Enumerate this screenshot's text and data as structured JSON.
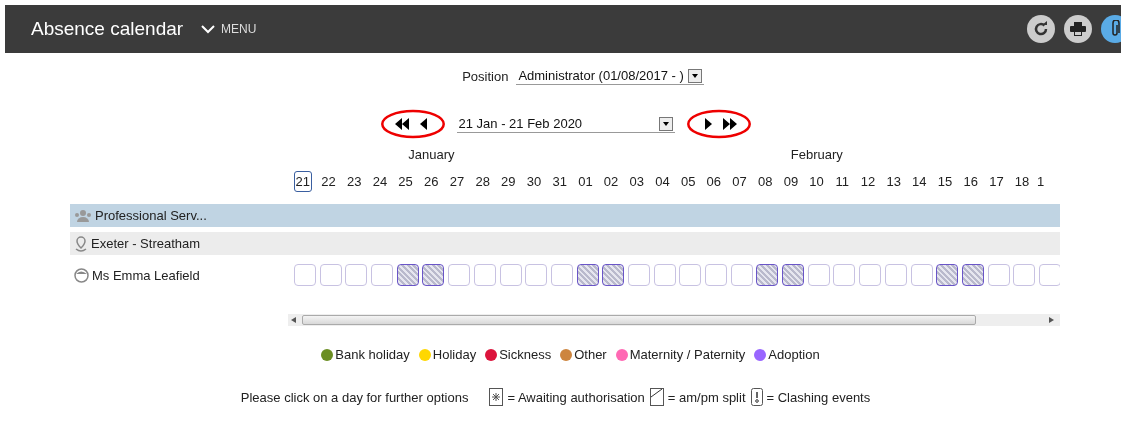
{
  "header": {
    "title": "Absence calendar",
    "menu": "MENU"
  },
  "position": {
    "label": "Position",
    "value": "Administrator (01/08/2017 - )"
  },
  "range": {
    "value": "21 Jan - 21 Feb 2020"
  },
  "months": [
    {
      "label": "January"
    },
    {
      "label": "February"
    }
  ],
  "days": [
    {
      "label": "21",
      "today": true,
      "weekend": false
    },
    {
      "label": "22",
      "today": false,
      "weekend": false
    },
    {
      "label": "23",
      "today": false,
      "weekend": false
    },
    {
      "label": "24",
      "today": false,
      "weekend": false
    },
    {
      "label": "25",
      "today": false,
      "weekend": true
    },
    {
      "label": "26",
      "today": false,
      "weekend": true
    },
    {
      "label": "27",
      "today": false,
      "weekend": false
    },
    {
      "label": "28",
      "today": false,
      "weekend": false
    },
    {
      "label": "29",
      "today": false,
      "weekend": false
    },
    {
      "label": "30",
      "today": false,
      "weekend": false
    },
    {
      "label": "31",
      "today": false,
      "weekend": false
    },
    {
      "label": "01",
      "today": false,
      "weekend": true
    },
    {
      "label": "02",
      "today": false,
      "weekend": true
    },
    {
      "label": "03",
      "today": false,
      "weekend": false
    },
    {
      "label": "04",
      "today": false,
      "weekend": false
    },
    {
      "label": "05",
      "today": false,
      "weekend": false
    },
    {
      "label": "06",
      "today": false,
      "weekend": false
    },
    {
      "label": "07",
      "today": false,
      "weekend": false
    },
    {
      "label": "08",
      "today": false,
      "weekend": true
    },
    {
      "label": "09",
      "today": false,
      "weekend": true
    },
    {
      "label": "10",
      "today": false,
      "weekend": false
    },
    {
      "label": "11",
      "today": false,
      "weekend": false
    },
    {
      "label": "12",
      "today": false,
      "weekend": false
    },
    {
      "label": "13",
      "today": false,
      "weekend": false
    },
    {
      "label": "14",
      "today": false,
      "weekend": false
    },
    {
      "label": "15",
      "today": false,
      "weekend": true
    },
    {
      "label": "16",
      "today": false,
      "weekend": true
    },
    {
      "label": "17",
      "today": false,
      "weekend": false
    },
    {
      "label": "18",
      "today": false,
      "weekend": false
    },
    {
      "label": "1",
      "today": false,
      "weekend": false
    }
  ],
  "rows": [
    {
      "kind": "group",
      "label": "Professional Serv..."
    },
    {
      "kind": "location",
      "label": "Exeter - Streatham"
    },
    {
      "kind": "person",
      "label": "Ms Emma Leafield"
    }
  ],
  "legend": [
    {
      "label": "Bank holiday",
      "color": "#6b8e23"
    },
    {
      "label": "Holiday",
      "color": "#ffd700"
    },
    {
      "label": "Sickness",
      "color": "#dc143c"
    },
    {
      "label": "Other",
      "color": "#cd853f"
    },
    {
      "label": "Maternity / Paternity",
      "color": "#ff69b4"
    },
    {
      "label": "Adoption",
      "color": "#9966ff"
    }
  ],
  "footer": {
    "hint": "Please click on a day for further options",
    "keys": [
      {
        "kind": "awaiting",
        "label": "= Awaiting authorisation"
      },
      {
        "kind": "split",
        "label": "= am/pm split"
      },
      {
        "kind": "clash",
        "label": "= Clashing events"
      }
    ]
  }
}
